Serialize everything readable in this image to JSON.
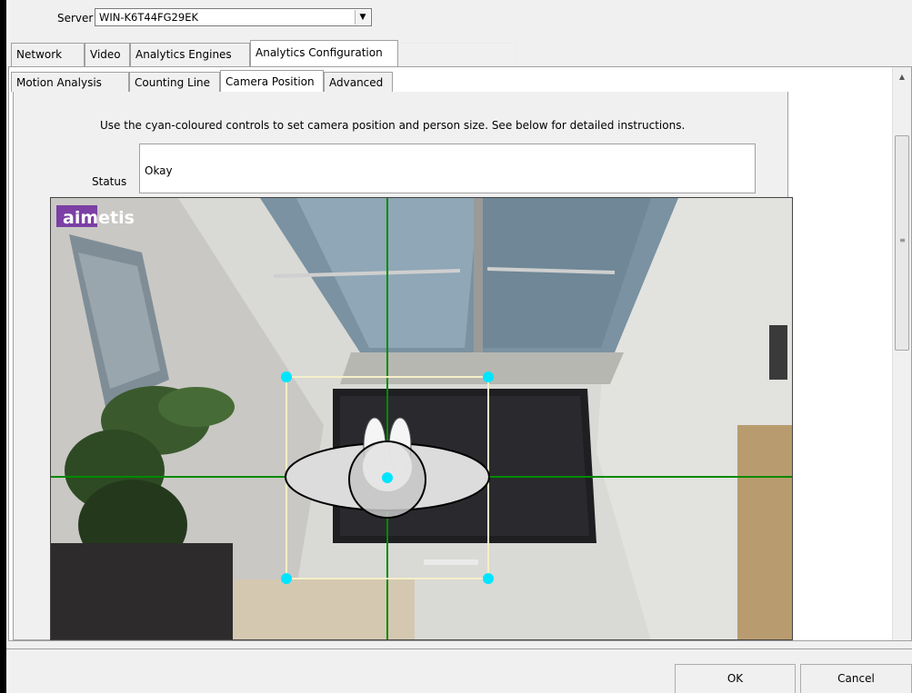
{
  "server": {
    "label": "Server",
    "value": "WIN-K6T44FG29EK"
  },
  "top_tabs": [
    "Network",
    "Video",
    "Analytics Engines",
    "Analytics Configuration"
  ],
  "active_top_tab": "Analytics Configuration",
  "sub_tabs": [
    "Motion Analysis",
    "Counting Line",
    "Camera Position",
    "Advanced"
  ],
  "active_sub_tab": "Camera Position",
  "instructions": "Use the cyan-coloured controls to set camera position and person size. See below for detailed instructions.",
  "status": {
    "label": "Status",
    "value": "Okay"
  },
  "camera": {
    "watermark": "aimetis",
    "control_color": "#00e5ff",
    "crosshair_color": "#008a00",
    "box_color": "#f5f0c8"
  },
  "buttons": {
    "ok": "OK",
    "cancel": "Cancel"
  }
}
